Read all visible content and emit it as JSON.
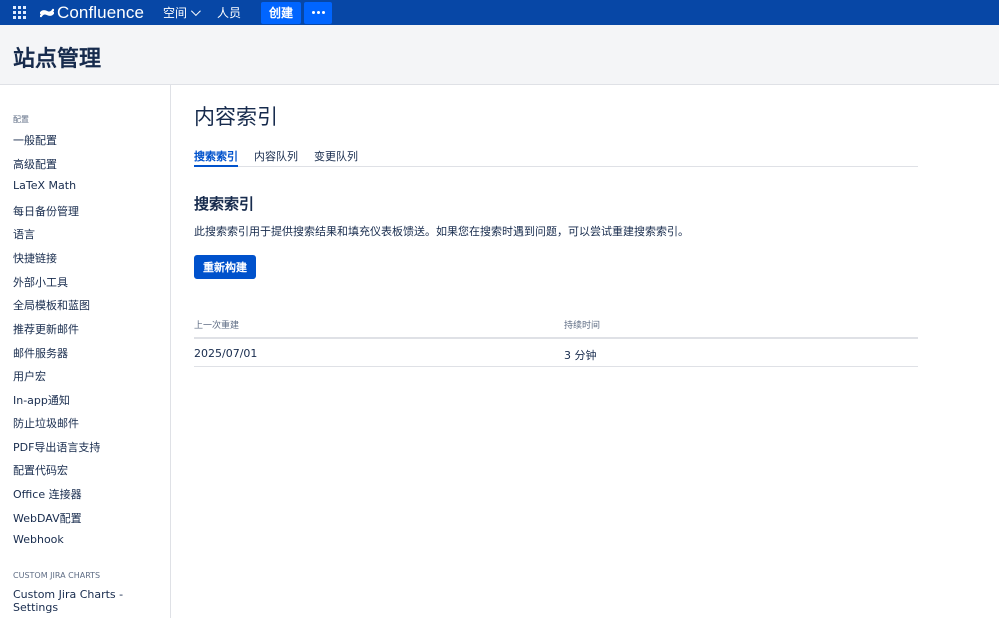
{
  "topnav": {
    "logo_text": "Confluence",
    "spaces_label": "空间",
    "people_label": "人员",
    "create_label": "创建",
    "colors": {
      "bar": "#0747a6",
      "button": "#0065ff"
    }
  },
  "page_header": {
    "title": "站点管理"
  },
  "sidebar": {
    "config_heading": "配置",
    "items": [
      {
        "label": "一般配置"
      },
      {
        "label": "高级配置"
      },
      {
        "label": "LaTeX Math"
      },
      {
        "label": "每日备份管理"
      },
      {
        "label": "语言"
      },
      {
        "label": "快捷链接"
      },
      {
        "label": "外部小工具"
      },
      {
        "label": "全局模板和蓝图"
      },
      {
        "label": "推荐更新邮件"
      },
      {
        "label": "邮件服务器"
      },
      {
        "label": "用户宏"
      },
      {
        "label": "In-app通知"
      },
      {
        "label": "防止垃圾邮件"
      },
      {
        "label": "PDF导出语言支持"
      },
      {
        "label": "配置代码宏"
      },
      {
        "label": "Office 连接器"
      },
      {
        "label": "WebDAV配置"
      },
      {
        "label": "Webhook"
      }
    ],
    "jira_heading": "CUSTOM JIRA CHARTS",
    "jira_items": [
      {
        "label": "Custom Jira Charts - Settings"
      }
    ]
  },
  "main": {
    "title": "内容索引",
    "tabs": [
      {
        "label": "搜索索引",
        "active": true
      },
      {
        "label": "内容队列",
        "active": false
      },
      {
        "label": "变更队列",
        "active": false
      }
    ],
    "section_title": "搜索索引",
    "description": "此搜索索引用于提供搜索结果和填充仪表板馈送。如果您在搜索时遇到问题，可以尝试重建搜索索引。",
    "rebuild_button": "重新构建",
    "table": {
      "columns": [
        "上一次重建",
        "持续时间"
      ],
      "rows": [
        [
          "2025/07/01",
          "3 分钟"
        ]
      ]
    }
  }
}
